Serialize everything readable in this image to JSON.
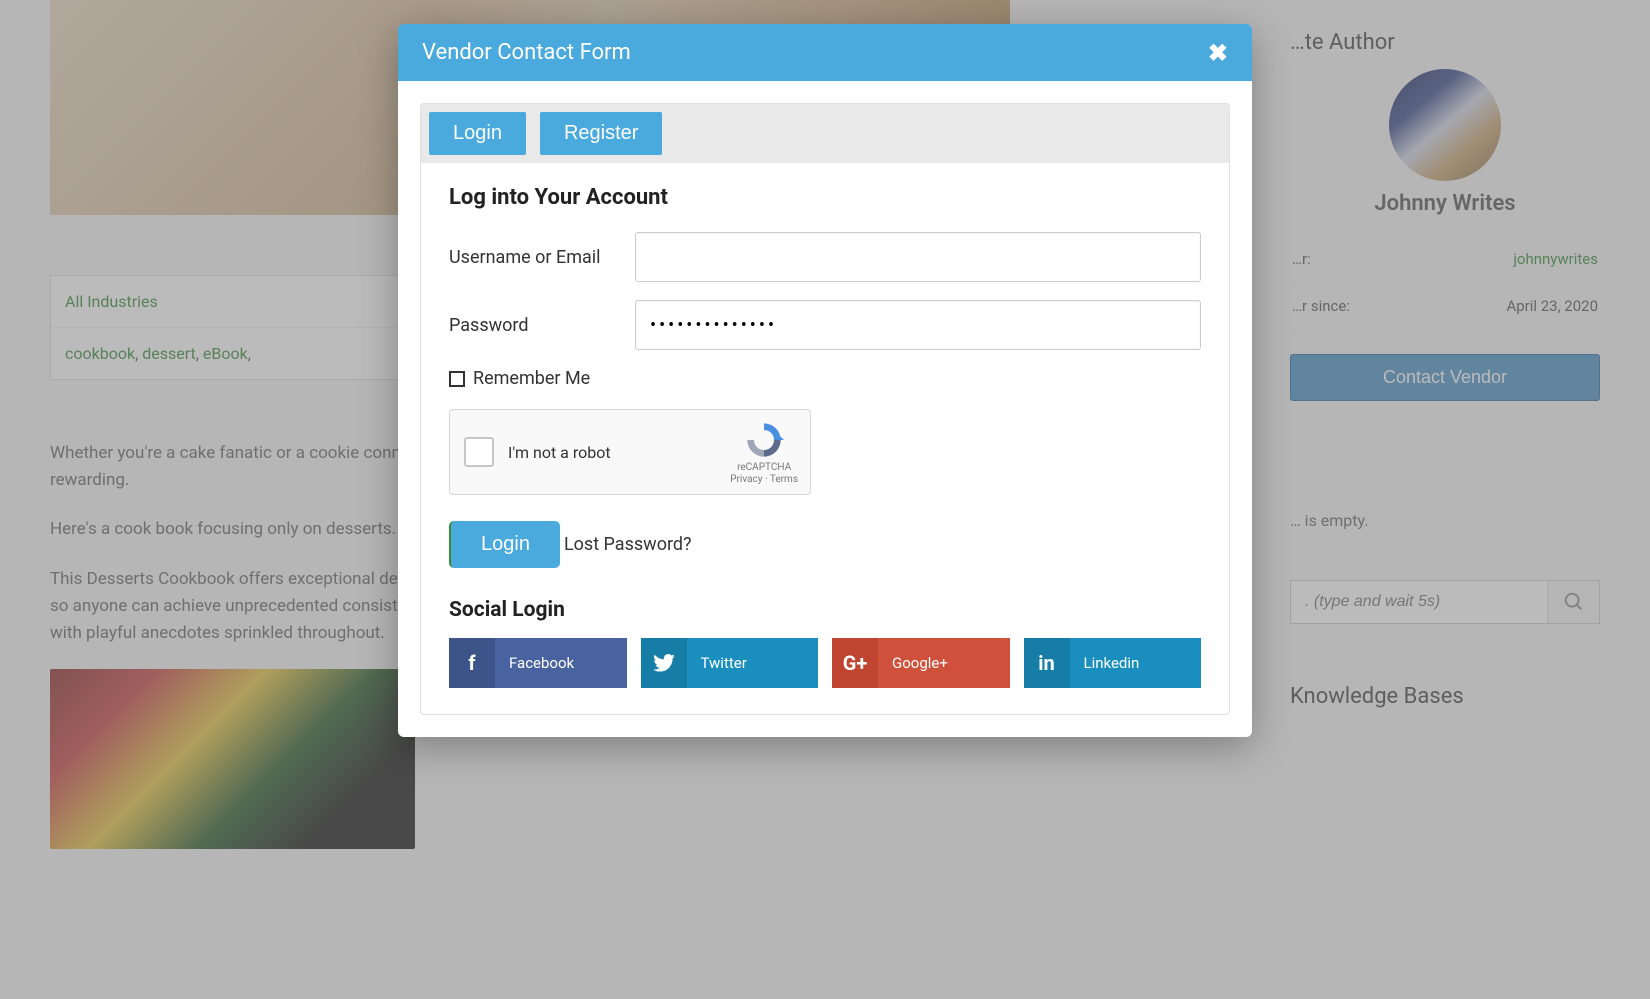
{
  "background": {
    "tags": {
      "row1": "All Industries",
      "row2_items": [
        "cookbook",
        "dessert",
        "eBook"
      ]
    },
    "paragraphs": [
      "Whether you're a cake fanatic or a cookie connoisseur, there's no denying that desserts are one of life's greatest pleasures. And creating them at home can be rewarding.",
      "Here's a cook book focusing only on desserts.",
      "This Desserts Cookbook offers exceptional desserts recipes for home cooks of all skill levels, using simple immersion circulators and accessible ingredients so anyone can achieve unprecedented consistency, taste, and culinary delight. Each recipe includes snapshots of the process as well as finishing directions, with playful anecdotes sprinkled throughout."
    ]
  },
  "sidebar": {
    "author_section_title": "…te Author",
    "author_name": "Johnny Writes",
    "rows": [
      {
        "label": "…r:",
        "value": "johnnywrites",
        "link": true
      },
      {
        "label": "…r since:",
        "value": "April 23, 2020",
        "link": false
      }
    ],
    "contact_button": "Contact Vendor",
    "empty_text": "… is empty.",
    "search_placeholder": ". (type and wait 5s)",
    "kb_title": "Knowledge Bases"
  },
  "modal": {
    "title": "Vendor Contact Form",
    "tabs": {
      "login": "Login",
      "register": "Register"
    },
    "form": {
      "heading": "Log into Your Account",
      "username_label": "Username or Email",
      "password_label": "Password",
      "password_value": "••••••••••••••",
      "remember_label": "Remember Me",
      "recaptcha_label": "I'm not a robot",
      "recaptcha_brand": "reCAPTCHA",
      "recaptcha_links": "Privacy · Terms",
      "login_button": "Login",
      "lost_password": "Lost Password?"
    },
    "social": {
      "heading": "Social Login",
      "buttons": [
        {
          "name": "Facebook",
          "icon": "f"
        },
        {
          "name": "Twitter",
          "icon": "tw"
        },
        {
          "name": "Google+",
          "icon": "G+"
        },
        {
          "name": "Linkedin",
          "icon": "in"
        }
      ]
    }
  }
}
